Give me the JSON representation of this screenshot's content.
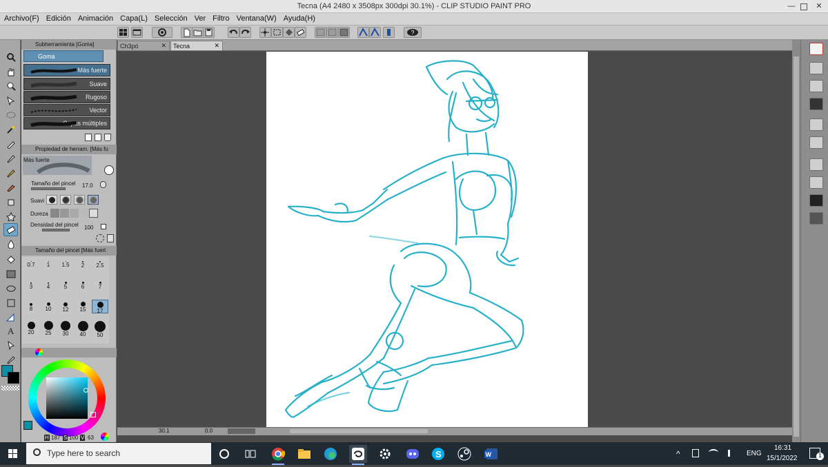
{
  "window": {
    "title": "Tecna (A4 2480 x 3508px 300dpi 30.1%)  - CLIP STUDIO PAINT PRO"
  },
  "menu": [
    "Archivo(F)",
    "Edición",
    "Animación",
    "Capa(L)",
    "Selección",
    "Ver",
    "Filtro",
    "Ventana(W)",
    "Ayuda(H)"
  ],
  "subtool": {
    "header": "Subherramienta [Goma]",
    "group": "Goma",
    "brushes": [
      "Más fuerte",
      "Suave",
      "Rugoso",
      "Vector",
      "Capas múltiples"
    ]
  },
  "tool_property": {
    "header": "Propiedad de herram. [Más fu",
    "preset_name": "Más fuerte",
    "brush_size_label": "Tamaño del pincel",
    "brush_size_value": "17.0",
    "softness_label": "Suavi",
    "hardness_label": "Dureza",
    "density_label": "Densidad del pincel",
    "density_value": "100"
  },
  "brush_size_panel": {
    "header": "Tamaño del pincel [Más fuert",
    "sizes": [
      "0.7",
      "1",
      "1.5",
      "2",
      "2.5",
      "3",
      "4",
      "5",
      "6",
      "7",
      "8",
      "10",
      "12",
      "15",
      "17",
      "20",
      "25",
      "30",
      "40",
      "50"
    ],
    "selected": "17"
  },
  "color": {
    "main": "#0b8fa6",
    "sub": "#000000",
    "h_value": "187",
    "s_value": "100",
    "v_value": "63",
    "h_label": "H",
    "s_label": "S",
    "v_label": "V"
  },
  "tabs": [
    "Ch3pó",
    "Tecna"
  ],
  "active_tab": "Tecna",
  "status": {
    "zoom": "30.1",
    "angle": "0.0"
  },
  "sketch_color": "#1cadc6",
  "taskbar": {
    "search_placeholder": "Type here to search",
    "language": "ENG",
    "time": "16:31",
    "date": "15/1/2022",
    "notification_count": "1"
  }
}
